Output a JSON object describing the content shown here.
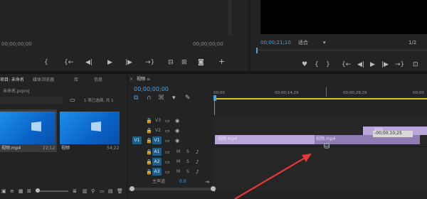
{
  "source_monitor": {
    "timecode_left": "00;00;00;00",
    "timecode_right": "00;00;00;00",
    "add_label": "+"
  },
  "program_monitor": {
    "timecode": "00;00;21;10",
    "fit_label": "适合",
    "page_label": "1/2"
  },
  "project_panel": {
    "tabs": [
      "项目: 未命名",
      "媒体浏览器",
      "库",
      "信息"
    ],
    "project_file": "未命名.prproj",
    "selection_info": "1 项已选择, 共 1",
    "thumbs": [
      {
        "name": "视频.mp4",
        "duration": "22;12"
      },
      {
        "name": "视频",
        "duration": "54;22"
      }
    ]
  },
  "timeline": {
    "title": "视频",
    "timecode": "00;00;00;00",
    "ruler_labels": [
      "00;00",
      "00;00;14;29",
      "00;00;29;29",
      "00;00"
    ],
    "tracks": [
      {
        "label": "V3"
      },
      {
        "label": "V2"
      },
      {
        "label": "V1",
        "source": "V1"
      },
      {
        "label": "A1",
        "source": "A1"
      },
      {
        "label": "A2"
      },
      {
        "label": "A3"
      }
    ],
    "master_label": "主声道",
    "master_value": "0.0",
    "clips": {
      "v1_a": "视频.mp4",
      "v1_b": "视频.mp4",
      "v2": "视频"
    },
    "drag_tooltip": "-00;00;10;25"
  },
  "colors": {
    "accent": "#4aa3df",
    "clip_purple": "#b9a6db",
    "arrow_red": "#e53935"
  }
}
